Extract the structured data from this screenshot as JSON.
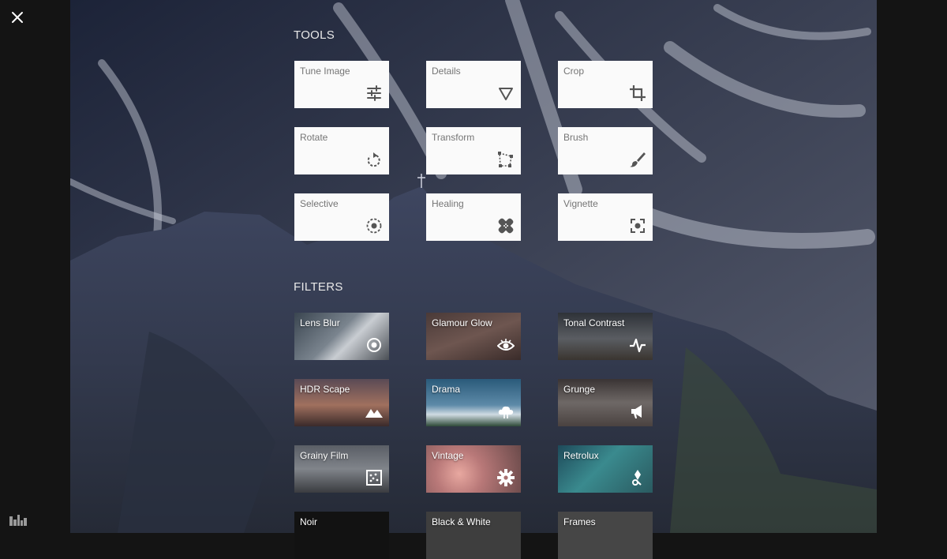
{
  "close": {
    "icon": "close-icon"
  },
  "histogram": {
    "icon": "histogram-icon"
  },
  "tools": {
    "title": "TOOLS",
    "items": [
      {
        "label": "Tune Image",
        "icon": "sliders-icon"
      },
      {
        "label": "Details",
        "icon": "triangle-down-icon"
      },
      {
        "label": "Crop",
        "icon": "crop-icon"
      },
      {
        "label": "Rotate",
        "icon": "rotate-icon"
      },
      {
        "label": "Transform",
        "icon": "transform-icon"
      },
      {
        "label": "Brush",
        "icon": "brush-icon"
      },
      {
        "label": "Selective",
        "icon": "selective-icon"
      },
      {
        "label": "Healing",
        "icon": "healing-icon"
      },
      {
        "label": "Vignette",
        "icon": "vignette-icon"
      }
    ]
  },
  "filters": {
    "title": "FILTERS",
    "items": [
      {
        "label": "Lens Blur",
        "icon": "lens-blur-icon"
      },
      {
        "label": "Glamour Glow",
        "icon": "eye-icon"
      },
      {
        "label": "Tonal Contrast",
        "icon": "pulse-icon"
      },
      {
        "label": "HDR Scape",
        "icon": "mountain-icon"
      },
      {
        "label": "Drama",
        "icon": "cloud-icon"
      },
      {
        "label": "Grunge",
        "icon": "megaphone-icon"
      },
      {
        "label": "Grainy Film",
        "icon": "film-grain-icon"
      },
      {
        "label": "Vintage",
        "icon": "gear-icon"
      },
      {
        "label": "Retrolux",
        "icon": "retrolux-icon"
      },
      {
        "label": "Noir",
        "icon": ""
      },
      {
        "label": "Black & White",
        "icon": ""
      },
      {
        "label": "Frames",
        "icon": ""
      }
    ]
  }
}
